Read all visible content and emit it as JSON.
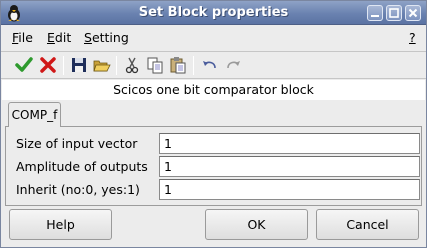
{
  "window": {
    "title": "Set Block properties"
  },
  "menu": {
    "file": {
      "first": "F",
      "rest": "ile"
    },
    "edit": {
      "first": "E",
      "rest": "dit"
    },
    "setting": {
      "first": "S",
      "rest": "etting"
    },
    "help": "?"
  },
  "toolbar": {
    "icons": [
      "check-icon",
      "cross-icon",
      "save-icon",
      "open-folder-icon",
      "cut-icon",
      "copy-icon",
      "paste-icon",
      "undo-icon",
      "redo-icon"
    ]
  },
  "description": "Scicos one bit comparator block",
  "tab": {
    "label": "COMP_f"
  },
  "fields": [
    {
      "label": "Size of input vector",
      "value": "1"
    },
    {
      "label": "Amplitude of outputs",
      "value": "1"
    },
    {
      "label": "Inherit (no:0, yes:1)",
      "value": "1"
    }
  ],
  "buttons": {
    "help": "Help",
    "ok": "OK",
    "cancel": "Cancel"
  },
  "colors": {
    "titlebar": "#6a82b0",
    "check": "#2e9a2e",
    "cross": "#d01818"
  }
}
